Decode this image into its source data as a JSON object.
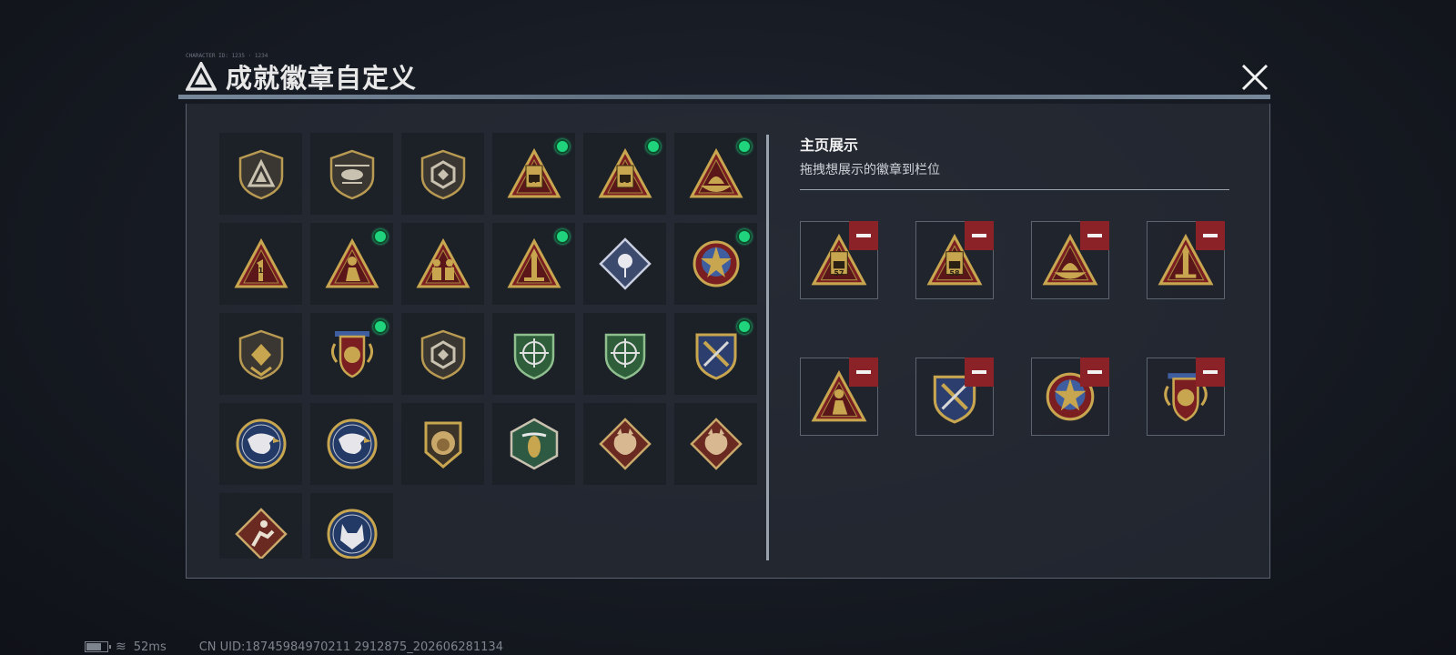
{
  "header": {
    "title": "成就徽章自定义",
    "tiny_text": "CHARACTER ID: 1235 · 1234",
    "logo_icon": "triangle-logo-icon",
    "close_icon": "close-icon"
  },
  "badge_grid": [
    {
      "icon": "shield-triangle-badge-icon",
      "equipped": false
    },
    {
      "icon": "helicopter-badge-icon",
      "equipped": false
    },
    {
      "icon": "shield-hex-badge-icon",
      "equipped": false
    },
    {
      "icon": "triangle-57-badge-icon",
      "label": "57",
      "equipped": true
    },
    {
      "icon": "triangle-58-badge-icon",
      "label": "58",
      "equipped": true
    },
    {
      "icon": "triangle-boat-badge-icon",
      "equipped": true
    },
    {
      "icon": "triangle-rank-1-badge-icon",
      "label": "1",
      "equipped": false
    },
    {
      "icon": "triangle-soldier-badge-icon",
      "equipped": true
    },
    {
      "icon": "triangle-squad-badge-icon",
      "equipped": false
    },
    {
      "icon": "triangle-rocket-badge-icon",
      "equipped": true
    },
    {
      "icon": "diamond-rose-badge-icon",
      "equipped": false
    },
    {
      "icon": "star-medal-badge-icon",
      "equipped": true
    },
    {
      "icon": "shield-chevron-badge-icon",
      "equipped": false
    },
    {
      "icon": "winged-shield-badge-icon",
      "equipped": true
    },
    {
      "icon": "shield-gem-badge-icon",
      "equipped": false
    },
    {
      "icon": "green-crosshair-badge-icon",
      "equipped": false
    },
    {
      "icon": "green-crosshair-badge-icon",
      "equipped": false
    },
    {
      "icon": "blue-crest-badge-icon",
      "equipped": true
    },
    {
      "icon": "eagle-badge-icon",
      "equipped": false
    },
    {
      "icon": "eagle-badge-icon",
      "equipped": false
    },
    {
      "icon": "lion-badge-icon",
      "equipped": false
    },
    {
      "icon": "wasp-hex-badge-icon",
      "equipped": false
    },
    {
      "icon": "dragon-diamond-badge-icon",
      "equipped": false
    },
    {
      "icon": "dragon-diamond-badge-icon",
      "equipped": false
    },
    {
      "icon": "runner-diamond-badge-icon",
      "equipped": false
    },
    {
      "icon": "wolf-badge-icon",
      "equipped": false
    }
  ],
  "showcase": {
    "title": "主页展示",
    "subtitle": "拖拽想展示的徽章到栏位",
    "remove_icon": "minus-icon",
    "slots": [
      {
        "icon": "triangle-57-badge-icon",
        "label": "57"
      },
      {
        "icon": "triangle-58-badge-icon",
        "label": "58"
      },
      {
        "icon": "triangle-boat-badge-icon"
      },
      {
        "icon": "triangle-rocket-badge-icon"
      },
      {
        "icon": "triangle-soldier-badge-icon"
      },
      {
        "icon": "blue-crest-badge-icon"
      },
      {
        "icon": "star-medal-badge-icon"
      },
      {
        "icon": "winged-shield-badge-icon"
      }
    ]
  },
  "status": {
    "battery_icon": "battery-icon",
    "wifi_icon": "wifi-icon",
    "ping": "52ms",
    "uid": "CN UID:18745984970211 2912875_202606281134"
  },
  "colors": {
    "gold": "#c8a650",
    "dark_red": "#7a1e22",
    "equipped_dot": "#1fd47c",
    "remove_red": "#8a2228"
  }
}
